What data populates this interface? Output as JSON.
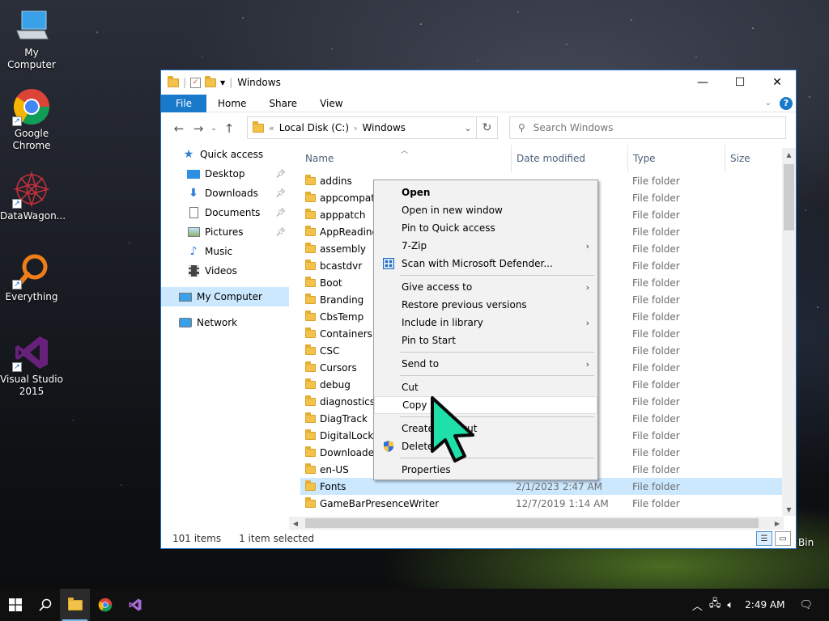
{
  "desktop": {
    "icons": [
      {
        "label": "My Computer"
      },
      {
        "label": "Google Chrome"
      },
      {
        "label": "DataWagon..."
      },
      {
        "label": "Everything"
      },
      {
        "label": "Visual Studio 2015"
      }
    ],
    "recycle_bin_partial": "Bin"
  },
  "window": {
    "title": "Windows",
    "ribbon": {
      "file": "File",
      "tabs": [
        "Home",
        "Share",
        "View"
      ],
      "help": "?"
    },
    "address": {
      "prefix": "«",
      "segments": [
        "Local Disk (C:)",
        "Windows"
      ]
    },
    "search": {
      "placeholder": "Search Windows"
    },
    "nav_pane": {
      "quick_access": "Quick access",
      "items": [
        {
          "label": "Desktop",
          "pinned": true
        },
        {
          "label": "Downloads",
          "pinned": true
        },
        {
          "label": "Documents",
          "pinned": true
        },
        {
          "label": "Pictures",
          "pinned": true
        },
        {
          "label": "Music",
          "pinned": false
        },
        {
          "label": "Videos",
          "pinned": false
        }
      ],
      "my_computer": "My Computer",
      "network": "Network"
    },
    "columns": {
      "name": "Name",
      "date": "Date modified",
      "type": "Type",
      "size": "Size"
    },
    "rows": [
      {
        "name": "addins",
        "date": "",
        "type": "File folder"
      },
      {
        "name": "appcompat",
        "date": "",
        "type": "File folder"
      },
      {
        "name": "apppatch",
        "date": "",
        "type": "File folder"
      },
      {
        "name": "AppReadine",
        "date": "",
        "type": "File folder"
      },
      {
        "name": "assembly",
        "date": "",
        "type": "File folder"
      },
      {
        "name": "bcastdvr",
        "date": "",
        "type": "File folder"
      },
      {
        "name": "Boot",
        "date": "",
        "type": "File folder"
      },
      {
        "name": "Branding",
        "date": "",
        "type": "File folder"
      },
      {
        "name": "CbsTemp",
        "date": "",
        "type": "File folder"
      },
      {
        "name": "Containers",
        "date": "",
        "type": "File folder"
      },
      {
        "name": "CSC",
        "date": "",
        "type": "File folder"
      },
      {
        "name": "Cursors",
        "date": "",
        "type": "File folder"
      },
      {
        "name": "debug",
        "date": "",
        "type": "File folder"
      },
      {
        "name": "diagnostics",
        "date": "",
        "type": "File folder"
      },
      {
        "name": "DiagTrack",
        "date": "",
        "type": "File folder"
      },
      {
        "name": "DigitalLocke",
        "date": "",
        "type": "File folder"
      },
      {
        "name": "Downloaded",
        "date": "",
        "type": "File folder"
      },
      {
        "name": "en-US",
        "date": "",
        "type": "File folder"
      },
      {
        "name": "Fonts",
        "date": "2/1/2023 2:47 AM",
        "type": "File folder"
      },
      {
        "name": "GameBarPresenceWriter",
        "date": "12/7/2019 1:14 AM",
        "type": "File folder"
      }
    ],
    "status": {
      "count": "101 items",
      "selected": "1 item selected"
    }
  },
  "context_menu": {
    "items": [
      {
        "label": "Open",
        "bold": true
      },
      {
        "label": "Open in new window"
      },
      {
        "label": "Pin to Quick access"
      },
      {
        "label": "7-Zip",
        "submenu": true
      },
      {
        "label": "Scan with Microsoft Defender...",
        "icon": "defender-icon"
      },
      {
        "divider": true
      },
      {
        "label": "Give access to",
        "submenu": true
      },
      {
        "label": "Restore previous versions"
      },
      {
        "label": "Include in library",
        "submenu": true
      },
      {
        "label": "Pin to Start"
      },
      {
        "divider": true
      },
      {
        "label": "Send to",
        "submenu": true
      },
      {
        "divider": true
      },
      {
        "label": "Cut"
      },
      {
        "label": "Copy",
        "hover": true
      },
      {
        "divider": true
      },
      {
        "label": "Create shortcut"
      },
      {
        "label": "Delete",
        "icon": "shield-icon"
      },
      {
        "divider": true
      },
      {
        "label": "Properties"
      }
    ]
  },
  "taskbar": {
    "clock": "2:49 AM"
  },
  "colors": {
    "accent": "#1979ca",
    "selection": "#cce8ff",
    "cursor": "#1fe0a8"
  }
}
